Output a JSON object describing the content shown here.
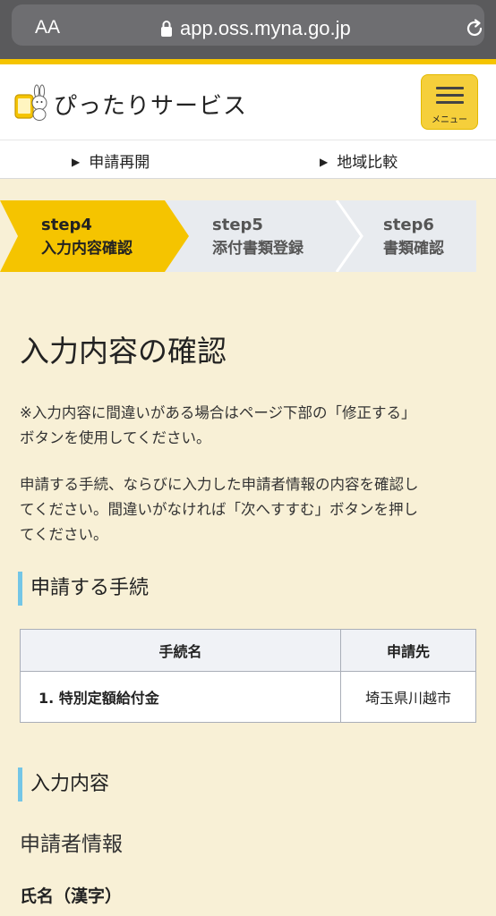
{
  "browser": {
    "aa_label": "AA",
    "url": "app.oss.myna.go.jp"
  },
  "header": {
    "logo_text": "ぴったりサービス",
    "menu_label": "メニュー"
  },
  "subnav": {
    "items": [
      {
        "label": "申請再開"
      },
      {
        "label": "地域比較"
      }
    ]
  },
  "steps": [
    {
      "num": "step4",
      "label": "入力内容確認",
      "state": "active"
    },
    {
      "num": "step5",
      "label": "添付書類登録",
      "state": "inactive"
    },
    {
      "num": "step6",
      "label": "書類確認",
      "state": "inactive"
    }
  ],
  "main": {
    "title": "入力内容の確認",
    "note_line1": "※入力内容に間違いがある場合はページ下部の「修正する」",
    "note_line2": "ボタンを使用してください。",
    "instr_line1": "申請する手続、ならびに入力した申請者情報の内容を確認し",
    "instr_line2": "てください。間違いがなければ「次へすすむ」ボタンを押し",
    "instr_line3": "てください。",
    "section_procedure": "申請する手続",
    "table": {
      "headers": [
        "手続名",
        "申請先"
      ],
      "rows": [
        {
          "name": "1. 特別定額給付金",
          "destination": "埼玉県川越市"
        }
      ]
    },
    "section_input": "入力内容",
    "applicant_heading": "申請者情報",
    "field_name_label": "氏名（漢字）"
  },
  "colors": {
    "accent": "#f5c400",
    "background": "#f8f0d6",
    "step_active": "#f5c400",
    "step_inactive": "#e8ebef",
    "section_bar": "#74c6e6"
  }
}
